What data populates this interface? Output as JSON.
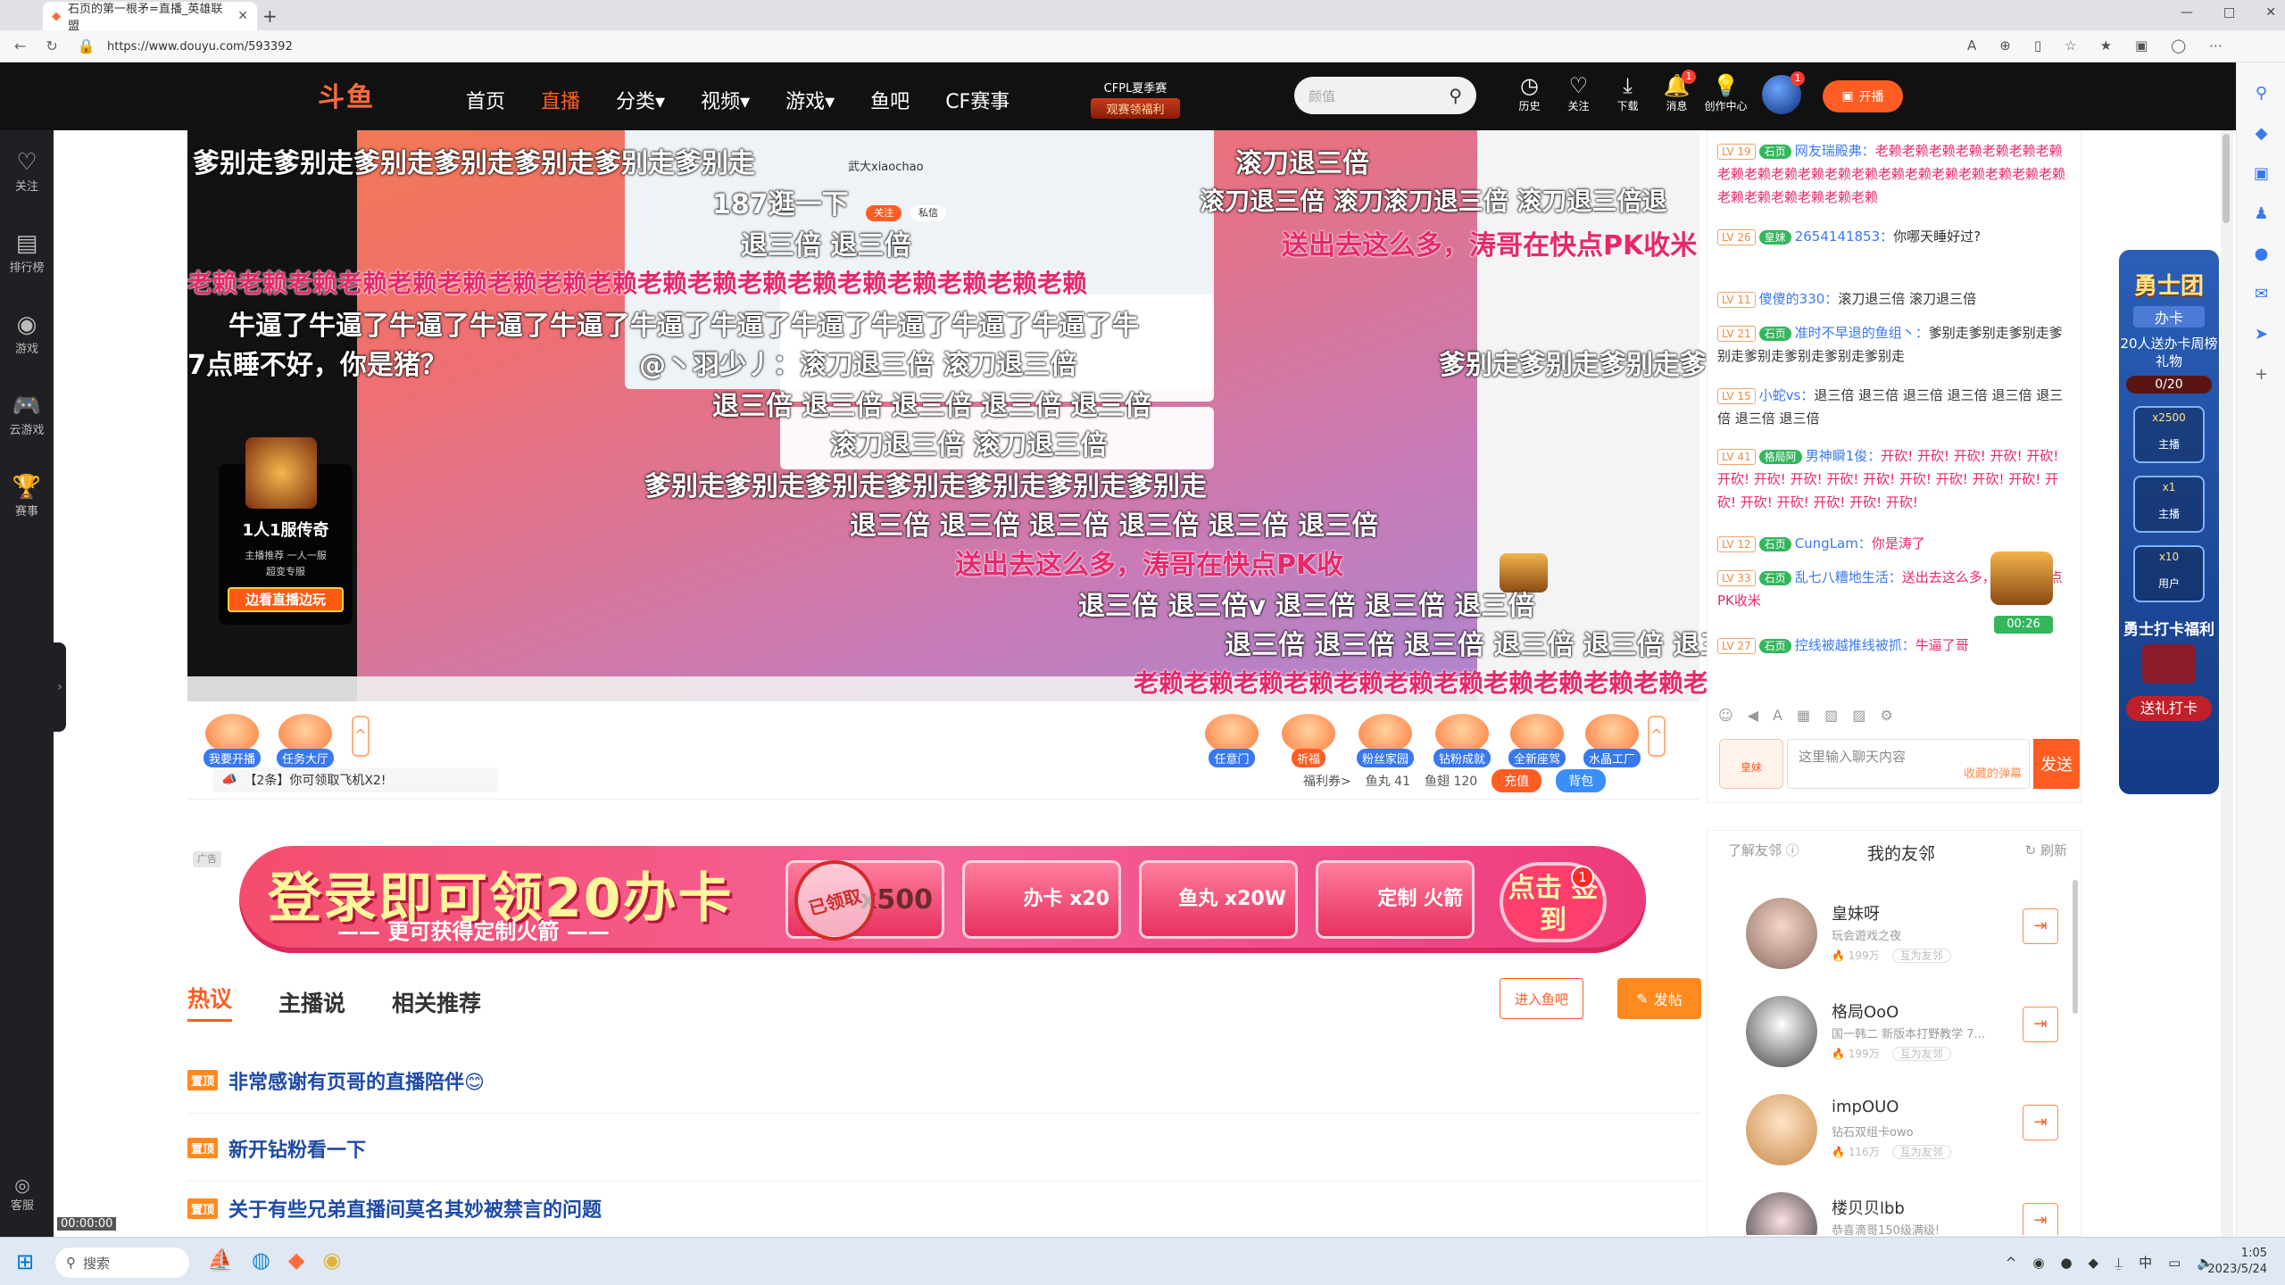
{
  "browser": {
    "tab_title": "石页的第一根矛=直播_英雄联盟",
    "url": "https://www.douyu.com/593392",
    "win_controls": [
      "—",
      "□",
      "✕"
    ]
  },
  "header": {
    "logo": "斗鱼",
    "nav": [
      "首页",
      "直播",
      "分类▾",
      "视频▾",
      "游戏▾",
      "鱼吧",
      "CF赛事"
    ],
    "cfpl_title": "CFPL夏季赛",
    "cfpl_badge": "观赛领福利",
    "search_placeholder": "颜值",
    "icons": [
      {
        "label": "历史",
        "glyph": "◷"
      },
      {
        "label": "关注",
        "glyph": "♡"
      },
      {
        "label": "下载",
        "glyph": "⤓"
      },
      {
        "label": "消息",
        "glyph": "🔔",
        "badge": "1"
      },
      {
        "label": "创作中心",
        "glyph": "💡"
      }
    ],
    "avatar_badge": "1",
    "kaibo": "开播"
  },
  "leftbar": [
    {
      "label": "关注",
      "glyph": "♡"
    },
    {
      "label": "排行榜",
      "glyph": "▤"
    },
    {
      "label": "游戏",
      "glyph": "◉"
    },
    {
      "label": "云游戏",
      "glyph": "🎮"
    },
    {
      "label": "赛事",
      "glyph": "🏆"
    }
  ],
  "kefu": "客服",
  "fps": "00:00:00",
  "danmaku": [
    {
      "text": "爹别走爹别走爹别走爹别走爹别走爹别走爹别走",
      "color": "white"
    },
    {
      "text": "滚刀退三倍",
      "color": "white"
    },
    {
      "text": "187逛一下",
      "color": "white"
    },
    {
      "text": "滚刀退三倍 滚刀滚刀退三倍 滚刀退三倍退",
      "color": "white"
    },
    {
      "text": "退三倍 退三倍",
      "color": "white"
    },
    {
      "text": "送出去这么多，涛哥在快点PK收米",
      "color": "red"
    },
    {
      "text": "老赖老赖老赖老赖老赖老赖老赖老赖老赖老赖老赖老赖老赖老赖老赖老赖老赖老赖",
      "color": "red"
    },
    {
      "text": "牛逼了牛逼了牛逼了牛逼了牛逼了牛逼了牛逼了牛逼了牛逼了牛逼了牛逼了牛",
      "color": "white"
    },
    {
      "text": "7点睡不好，你是猪？",
      "color": "white"
    },
    {
      "text": "@丶羽少丿：滚刀退三倍 滚刀退三倍",
      "color": "white"
    },
    {
      "text": "爹别走爹别走爹别走爹",
      "color": "white"
    },
    {
      "text": "退三倍 退三倍 退三倍 退三倍 退三倍",
      "color": "white"
    },
    {
      "text": "滚刀退三倍 滚刀退三倍",
      "color": "white"
    },
    {
      "text": "爹别走爹别走爹别走爹别走爹别走爹别走爹别走",
      "color": "white"
    },
    {
      "text": "退三倍 退三倍 退三倍 退三倍 退三倍 退三倍",
      "color": "white"
    },
    {
      "text": "送出去这么多，涛哥在快点PK收",
      "color": "red"
    },
    {
      "text": "退三倍 退三倍v 退三倍 退三倍 退三倍",
      "color": "white"
    },
    {
      "text": "退三倍 退三倍 退三倍 退三倍 退三倍 退三",
      "color": "white"
    },
    {
      "text": "老赖老赖老赖老赖老赖老赖老赖老赖老赖老赖老赖老赖",
      "color": "red"
    }
  ],
  "stream_card": {
    "name": "武大xiaochao",
    "btn1": "关注",
    "btn2": "私信"
  },
  "game_ad": {
    "title": "1人1服传奇",
    "tags": "主播推荐 一人一服",
    "tag2": "超变专服",
    "btn": "边看直播边玩"
  },
  "toolbar": [
    {
      "label": "我要开播",
      "style": "blue"
    },
    {
      "label": "任务大厅",
      "style": "blue"
    },
    {
      "label": "任意门",
      "style": "blue"
    },
    {
      "label": "祈福",
      "style": "orange"
    },
    {
      "label": "粉丝家园",
      "style": "blue"
    },
    {
      "label": "钻粉成就",
      "style": "blue"
    },
    {
      "label": "全新座驾",
      "style": "blue"
    },
    {
      "label": "水晶工厂",
      "style": "blue"
    }
  ],
  "notice": "【2条】你可领取飞机X2!",
  "wallet": {
    "fuli": "福利券>",
    "yuwan": "鱼丸 41",
    "yuchi": "鱼翅 120",
    "chongzhi": "充值",
    "beibao": "背包"
  },
  "chat": [
    {
      "lv": "LV 19",
      "fan": "石页",
      "name": "网友瑞殿弗：",
      "text": "老赖老赖老赖老赖老赖老赖老赖老赖老赖老赖老赖老赖老赖老赖老赖老赖老赖老赖老赖老赖老赖老赖老赖老赖老赖老赖",
      "pink": true
    },
    {
      "lv": "LV 26",
      "fan": "皇妹",
      "name": "2654141853：",
      "text": "你哪天睡好过?",
      "pink": false
    },
    {
      "lv": "LV 11",
      "fan": "",
      "name": "傻傻的330：",
      "text": "滚刀退三倍 滚刀退三倍",
      "pink": false
    },
    {
      "lv": "LV 21",
      "fan": "石页",
      "name": "准时不早退的鱼组丶：",
      "text": "爹别走爹别走爹别走爹别走爹别走爹别走爹别走爹别走",
      "pink": false
    },
    {
      "lv": "LV 15",
      "fan": "",
      "name": "小蛇vs：",
      "text": "退三倍 退三倍 退三倍 退三倍 退三倍 退三倍 退三倍 退三倍",
      "pink": false
    },
    {
      "lv": "LV 41",
      "fan": "格局阿",
      "name": "男神瞬1俊：",
      "text": "开砍! 开砍! 开砍! 开砍! 开砍! 开砍! 开砍! 开砍! 开砍! 开砍! 开砍! 开砍! 开砍! 开砍! 开砍! 开砍! 开砍! 开砍! 开砍! 开砍!",
      "pink": true
    },
    {
      "lv": "LV 12",
      "fan": "石页",
      "name": "CungLam：",
      "text": "你是涛了",
      "pink": true
    },
    {
      "lv": "LV 33",
      "fan": "石页",
      "name": "乱七八糟地生活：",
      "text": "送出去这么多，涛哥在快点PK收米",
      "pink": true
    },
    {
      "lv": "LV 27",
      "fan": "石页",
      "name": "控线被越推线被抓：",
      "text": "牛逼了哥",
      "pink": true
    }
  ],
  "chat_timer": "00:26",
  "chat_tools": [
    "☺",
    "◀",
    "A",
    "▦",
    "▧",
    "▨",
    "⚙"
  ],
  "chat_fan_badge": "皇妹",
  "chat_input_placeholder": "这里输入聊天内容",
  "chat_gift_hint": "收藏的弹幕",
  "send": "发送",
  "event": {
    "title": "勇士团",
    "banka": "办卡",
    "sub": "20人送办卡周榜礼物",
    "progress_text": "0/20",
    "progress_value": 0,
    "card1_count": "x2500",
    "card1_label": "主播",
    "card2_count": "x1",
    "card2_label": "主播",
    "card3_count": "x10",
    "card3_label": "用户",
    "bottom_title": "勇士打卡福利",
    "bottom_btn": "送礼打卡"
  },
  "banner": {
    "ad_tag": "广告",
    "main": "登录即可领20办卡",
    "sub": "—— 更可获得定制火箭 ——",
    "stamp": "已领取",
    "stamp_under": "x500",
    "card1": "办卡 x20",
    "card2": "鱼丸 x20W",
    "card3": "定制 火箭",
    "sign": "点击 签到",
    "sign_badge": "1"
  },
  "tabs": [
    "热议",
    "主播说",
    "相关推荐"
  ],
  "yuba_btn": "进入鱼吧",
  "post_btn": "发帖",
  "posts": [
    {
      "pin": "置顶",
      "title": "非常感谢有页哥的直播陪伴😊"
    },
    {
      "pin": "置顶",
      "title": "新开钻粉看一下"
    },
    {
      "pin": "置顶",
      "title": "关于有些兄弟直播间莫名其妙被禁言的问题"
    }
  ],
  "friends": {
    "about": "了解友邻 ⓘ",
    "title": "我的友邻",
    "refresh": "刷新",
    "list": [
      {
        "name": "皇妹呀",
        "desc": "玩会遊戏之夜",
        "heat": "199万",
        "tag": "互为友邻"
      },
      {
        "name": "格局OoO",
        "desc": "国一韩二 新版本打野教学 7...",
        "heat": "199万",
        "tag": "互为友邻"
      },
      {
        "name": "impOUO",
        "desc": "钻石双组卡owo",
        "heat": "116万",
        "tag": "互为友邻"
      },
      {
        "name": "楼贝贝lbb",
        "desc": "恭喜滴哥150级满级!",
        "heat": "",
        "tag": ""
      }
    ]
  },
  "taskbar": {
    "search": "搜索",
    "time": "1:05",
    "date": "2023/5/24",
    "ime": "中"
  },
  "colors": {
    "brand": "#ff5d23",
    "header_bg": "#111111",
    "danmaku_red": "#e8286b"
  }
}
